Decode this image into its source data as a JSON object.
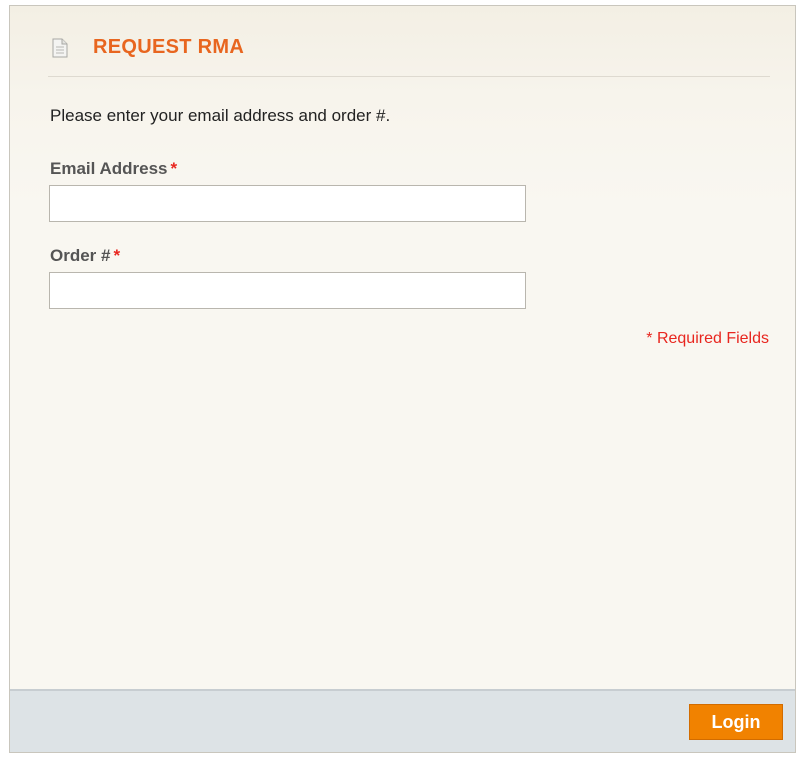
{
  "header": {
    "title": "REQUEST RMA",
    "icon": "document-icon"
  },
  "form": {
    "intro_text": "Please enter your email address and order #.",
    "email_label": "Email Address",
    "order_label": "Order #",
    "required_marker": "*",
    "email_value": "",
    "order_value": "",
    "required_note": "* Required Fields"
  },
  "footer": {
    "login_label": "Login"
  },
  "colors": {
    "accent": "#e8661f",
    "required": "#e8261f",
    "button": "#f18200",
    "footer_bg": "#dde3e6",
    "panel_bg": "#f9f7f1"
  }
}
